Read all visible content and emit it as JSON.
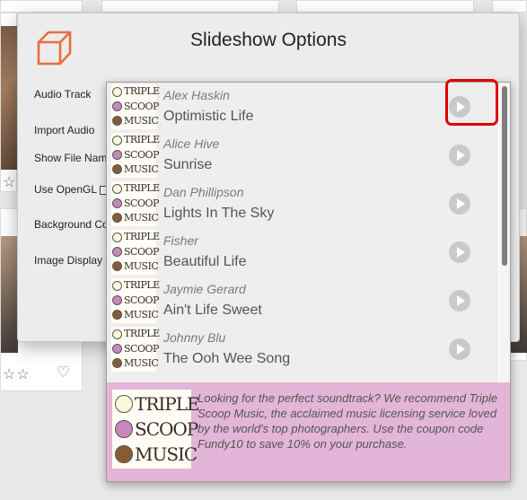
{
  "dialog": {
    "title": "Slideshow Options",
    "options": [
      "Audio Track",
      "Import Audio",
      "Show File Nam",
      "Use OpenGL",
      "Background Co",
      "Image Display"
    ]
  },
  "tracks": [
    {
      "artist": "Alex Haskin",
      "song": "Optimistic Life"
    },
    {
      "artist": "Alice Hive",
      "song": "Sunrise"
    },
    {
      "artist": "Dan Phillipson",
      "song": "Lights In The Sky"
    },
    {
      "artist": "Fisher",
      "song": "Beautiful Life"
    },
    {
      "artist": "Jaymie Gerard",
      "song": "Ain't Life Sweet"
    },
    {
      "artist": "Johnny Blu",
      "song": "The Ooh Wee Song"
    }
  ],
  "brand": {
    "line1": "TRIPLE",
    "line2": "SCOOP",
    "line3": "MUSIC"
  },
  "promo": {
    "text": "Looking for the perfect soundtrack? We recommend Triple Scoop Music, the acclaimed music licensing service loved by the world's top photographers.  Use the coupon code Fundy10 to save 10% on your purchase."
  },
  "background": {
    "stars": "☆☆",
    "heart": "♡"
  },
  "colors": {
    "accent": "#e07a4f",
    "highlight": "#e00000",
    "promo_bg": "#e3b5d8"
  }
}
